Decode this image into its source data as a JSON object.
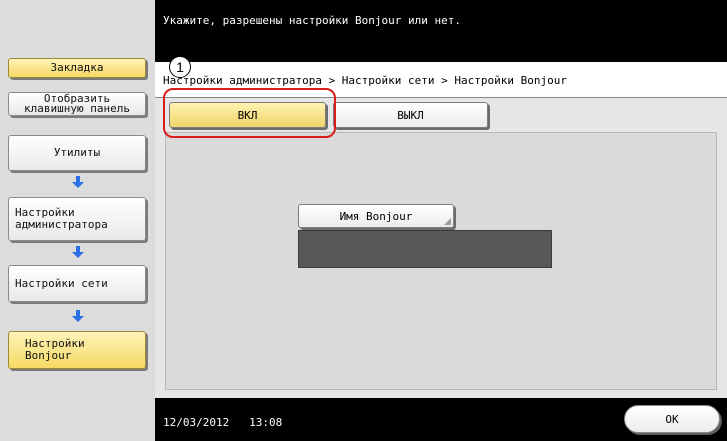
{
  "header": {
    "message": "Укажите, разрешены настройки Bonjour или нет."
  },
  "breadcrumb": "Настройки администратора > Настройки сети > Настройки Bonjour",
  "left_panel": {
    "bookmark": "Закладка",
    "show_keypad_line1": "Отобразить",
    "show_keypad_line2": "клавишную панель",
    "utilities": "Утилиты",
    "admin_settings_line1": "Настройки",
    "admin_settings_line2": "администратора",
    "network_settings": "Настройки сети",
    "bonjour_settings_line1": "Настройки",
    "bonjour_settings_line2": "Bonjour",
    "arrow_icon": "arrow-down-icon",
    "arrow_color": "#2a6fe6"
  },
  "toggle": {
    "on_label": "ВКЛ",
    "off_label": "ВЫКЛ",
    "selected": "ВКЛ"
  },
  "bonjour_name": {
    "button_label": "Имя Bonjour",
    "value": ""
  },
  "callout": {
    "number": "1",
    "highlight_color": "#d81d1d"
  },
  "footer": {
    "date": "12/03/2012",
    "time": "13:08",
    "ok_label": "OK"
  }
}
